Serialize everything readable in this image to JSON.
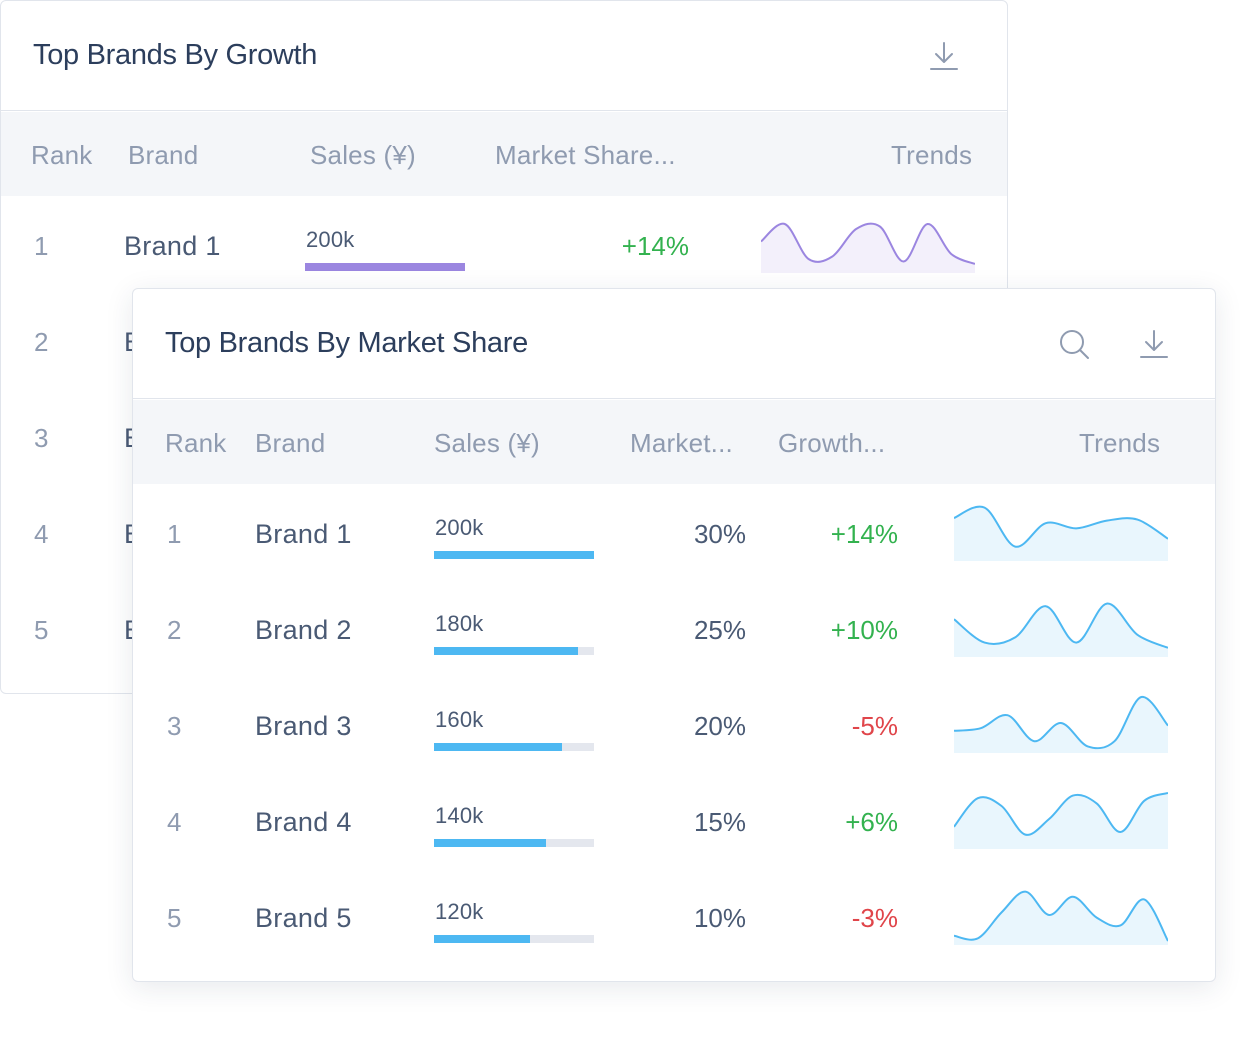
{
  "back_panel": {
    "title": "Top Brands By Growth",
    "columns": {
      "rank": "Rank",
      "brand": "Brand",
      "sales": "Sales (¥)",
      "share": "Market Share...",
      "trends": "Trends"
    },
    "accent": "#9b86e0",
    "rows": [
      {
        "rank": "1",
        "brand": "Brand 1",
        "sales": "200k",
        "sales_fraction": 1.0,
        "growth": "+14%",
        "trend": [
          0.55,
          0.9,
          0.2,
          0.25,
          0.8,
          0.85,
          0.15,
          0.9,
          0.3,
          0.1
        ]
      },
      {
        "rank": "2",
        "brand": "E"
      },
      {
        "rank": "3",
        "brand": "E"
      },
      {
        "rank": "4",
        "brand": "E"
      },
      {
        "rank": "5",
        "brand": "E"
      }
    ]
  },
  "front_panel": {
    "title": "Top Brands By Market Share",
    "columns": {
      "rank": "Rank",
      "brand": "Brand",
      "sales": "Sales (¥)",
      "share": "Market...",
      "growth": "Growth...",
      "trends": "Trends"
    },
    "accent": "#4db8f2",
    "rows": [
      {
        "rank": "1",
        "brand": "Brand 1",
        "sales": "200k",
        "sales_fraction": 1.0,
        "share": "30%",
        "growth": "+14%",
        "growth_positive": true,
        "trend": [
          0.75,
          0.95,
          0.2,
          0.65,
          0.55,
          0.7,
          0.72,
          0.35
        ]
      },
      {
        "rank": "2",
        "brand": "Brand 2",
        "sales": "180k",
        "sales_fraction": 0.9,
        "share": "25%",
        "growth": "+10%",
        "growth_positive": true,
        "trend": [
          0.65,
          0.2,
          0.3,
          0.9,
          0.2,
          0.95,
          0.35,
          0.1
        ]
      },
      {
        "rank": "3",
        "brand": "Brand 3",
        "sales": "160k",
        "sales_fraction": 0.8,
        "share": "20%",
        "growth": "-5%",
        "growth_positive": false,
        "trend": [
          0.35,
          0.4,
          0.65,
          0.15,
          0.5,
          0.05,
          0.15,
          1.0,
          0.45
        ]
      },
      {
        "rank": "4",
        "brand": "Brand 4",
        "sales": "140k",
        "sales_fraction": 0.7,
        "share": "15%",
        "growth": "+6%",
        "growth_positive": true,
        "trend": [
          0.35,
          0.9,
          0.75,
          0.2,
          0.5,
          0.95,
          0.8,
          0.25,
          0.85,
          1.0
        ]
      },
      {
        "rank": "5",
        "brand": "Brand 5",
        "sales": "120k",
        "sales_fraction": 0.6,
        "share": "10%",
        "growth": "-3%",
        "growth_positive": false,
        "trend": [
          0.1,
          0.05,
          0.55,
          0.95,
          0.5,
          0.85,
          0.45,
          0.3,
          0.8,
          0.0
        ]
      }
    ]
  },
  "icons": {
    "download": "download-icon",
    "search": "search-icon"
  },
  "colors": {
    "positive": "#33b24f",
    "negative": "#e0454a",
    "header_bg": "#f4f6f9",
    "border": "#e1e5ec"
  }
}
